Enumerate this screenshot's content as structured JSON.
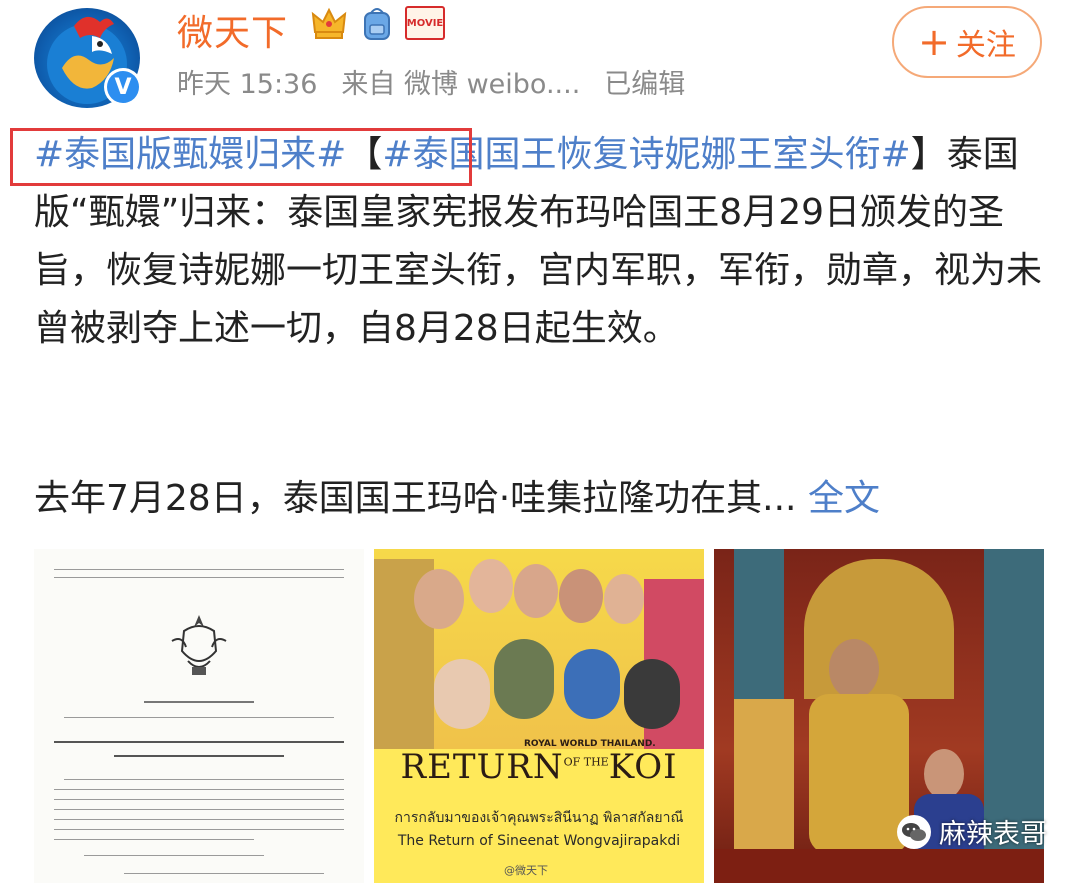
{
  "header": {
    "username": "微天下",
    "time": "昨天 15:36",
    "source": "来自 微博 weibo....",
    "edited": "已编辑",
    "follow_plus": "+",
    "follow_label": "关注",
    "movie_badge": "MOVIE",
    "verified_mark": "V"
  },
  "post": {
    "tag1": "#泰国版甄嬛归来#",
    "bracket_open": "【",
    "tag2": "#泰国国王恢复诗妮娜王室头衔#",
    "body": "】泰国版“甄嬛”归来：泰国皇家宪报发布玛哈国王8月29日颁发的圣旨，恢复诗妮娜一切王室头衔，宫内军职，军衔，勋章，视为未曾被剥夺上述一切，自8月28日起生效。",
    "para2": "去年7月28日，泰国国王玛哈·哇集拉隆功在其...",
    "full_text_link": "全文"
  },
  "images": {
    "koi_royal": "ROYAL WORLD THAILAND.",
    "koi_title_a": "RETURN",
    "koi_title_of": "OF THE",
    "koi_title_b": "KOI",
    "koi_thai": "การกลับมาของเจ้าคุณพระสินีนาฏ พิลาสกัลยาณี",
    "koi_sub": "The Return of Sineenat Wongvajirapakdi",
    "weibo_wm": "@微天下",
    "wechat_wm": "麻辣表哥"
  },
  "colors": {
    "accent_orange": "#f26b2a",
    "link_blue": "#4e7fc9",
    "highlight_red": "#e23b3b"
  }
}
